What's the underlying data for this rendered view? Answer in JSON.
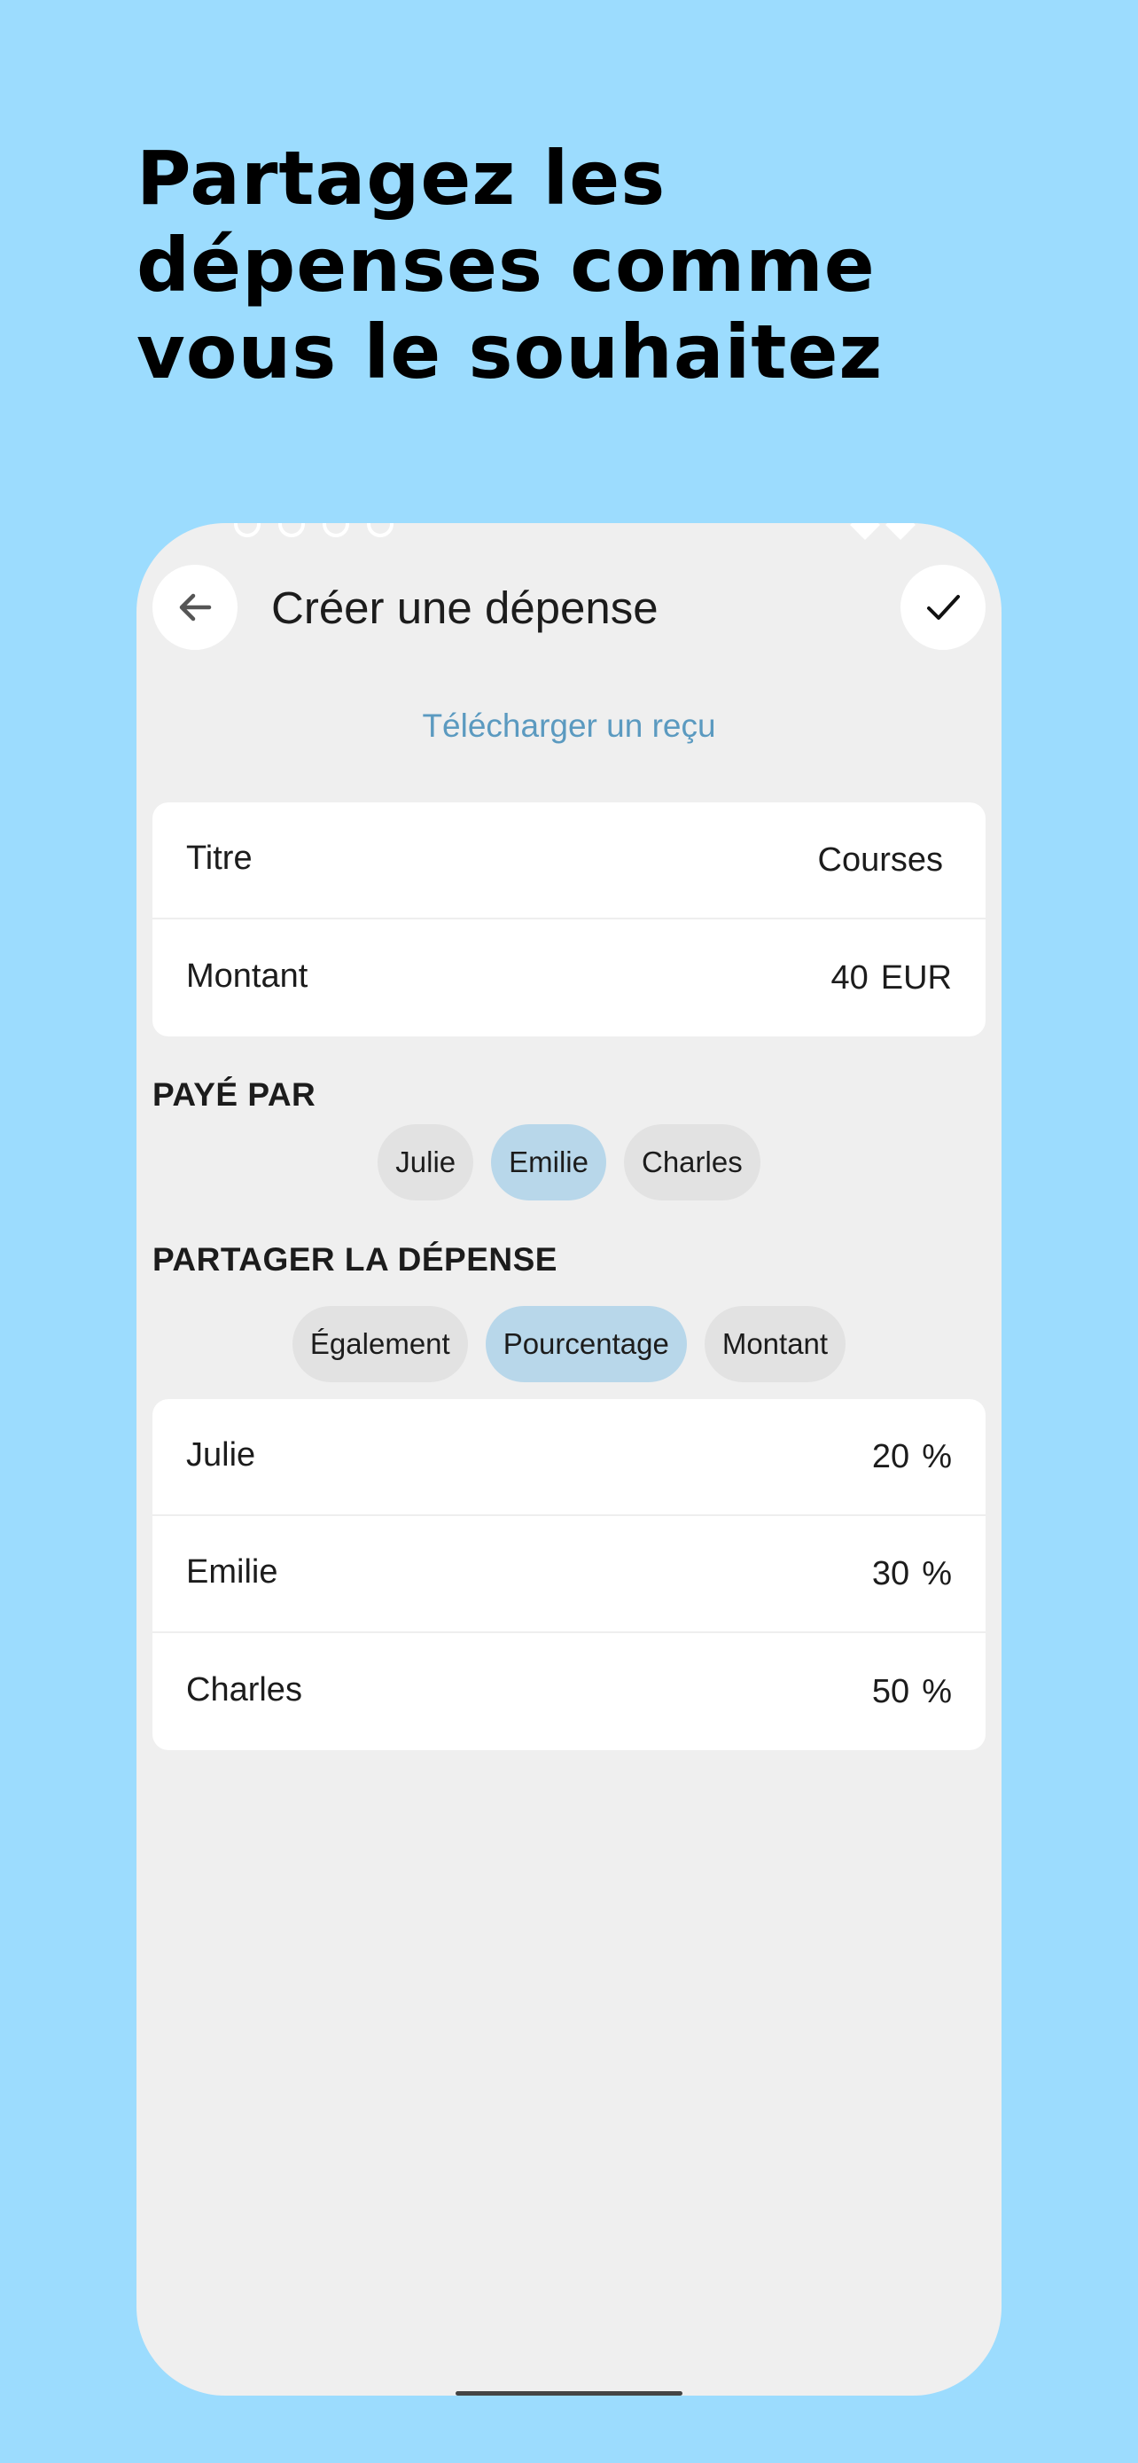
{
  "headline": "Partagez les dépenses comme vous le souhaitez",
  "appbar": {
    "title": "Créer une dépense",
    "back_icon": "arrow-left-icon",
    "confirm_icon": "check-icon"
  },
  "upload_receipt": "Télécharger un reçu",
  "expense": {
    "title_label": "Titre",
    "title_value": "Courses",
    "amount_label": "Montant",
    "amount_value": "40",
    "currency": "EUR"
  },
  "paid_by": {
    "heading": "PAYÉ PAR",
    "options": [
      "Julie",
      "Emilie",
      "Charles"
    ],
    "selected": "Emilie"
  },
  "split": {
    "heading": "PARTAGER LA DÉPENSE",
    "modes": [
      "Également",
      "Pourcentage",
      "Montant"
    ],
    "selected_mode": "Pourcentage",
    "rows": [
      {
        "name": "Julie",
        "value": "20",
        "unit": "%"
      },
      {
        "name": "Emilie",
        "value": "30",
        "unit": "%"
      },
      {
        "name": "Charles",
        "value": "50",
        "unit": "%"
      }
    ]
  },
  "colors": {
    "background": "#9cdcfe",
    "screen": "#efefef",
    "accent_link": "#5b9ac0",
    "chip_selected": "#b8d7ea",
    "chip_default": "#e2e2e2"
  }
}
